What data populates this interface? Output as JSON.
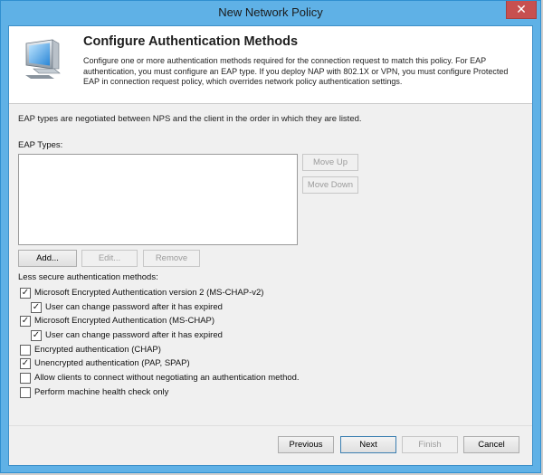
{
  "window": {
    "title": "New Network Policy",
    "close_glyph": "✕"
  },
  "header": {
    "title": "Configure Authentication Methods",
    "description": "Configure one or more authentication methods required for the connection request to match this policy. For EAP authentication, you must configure an EAP type. If you deploy NAP with 802.1X or VPN, you must configure Protected EAP in connection request policy, which overrides network policy authentication settings.",
    "icon": "monitor-network-icon"
  },
  "intro": "EAP types are negotiated between NPS and the client in the order in which they are listed.",
  "eap": {
    "label": "EAP Types:",
    "items": [],
    "move_up": "Move Up",
    "move_down": "Move Down",
    "add": "Add...",
    "edit": "Edit...",
    "remove": "Remove"
  },
  "auth": {
    "label": "Less secure authentication methods:",
    "options": [
      {
        "label": "Microsoft Encrypted Authentication version 2 (MS-CHAP-v2)",
        "checked": true,
        "indent": false
      },
      {
        "label": "User can change password after it has expired",
        "checked": true,
        "indent": true
      },
      {
        "label": "Microsoft Encrypted Authentication (MS-CHAP)",
        "checked": true,
        "indent": false
      },
      {
        "label": "User can change password after it has expired",
        "checked": true,
        "indent": true
      },
      {
        "label": "Encrypted authentication (CHAP)",
        "checked": false,
        "indent": false
      },
      {
        "label": "Unencrypted authentication (PAP, SPAP)",
        "checked": true,
        "indent": false
      },
      {
        "label": "Allow clients to connect without negotiating an authentication method.",
        "checked": false,
        "indent": false
      },
      {
        "label": "Perform machine health check only",
        "checked": false,
        "indent": false
      }
    ]
  },
  "footer": {
    "previous": "Previous",
    "next": "Next",
    "finish": "Finish",
    "cancel": "Cancel"
  }
}
